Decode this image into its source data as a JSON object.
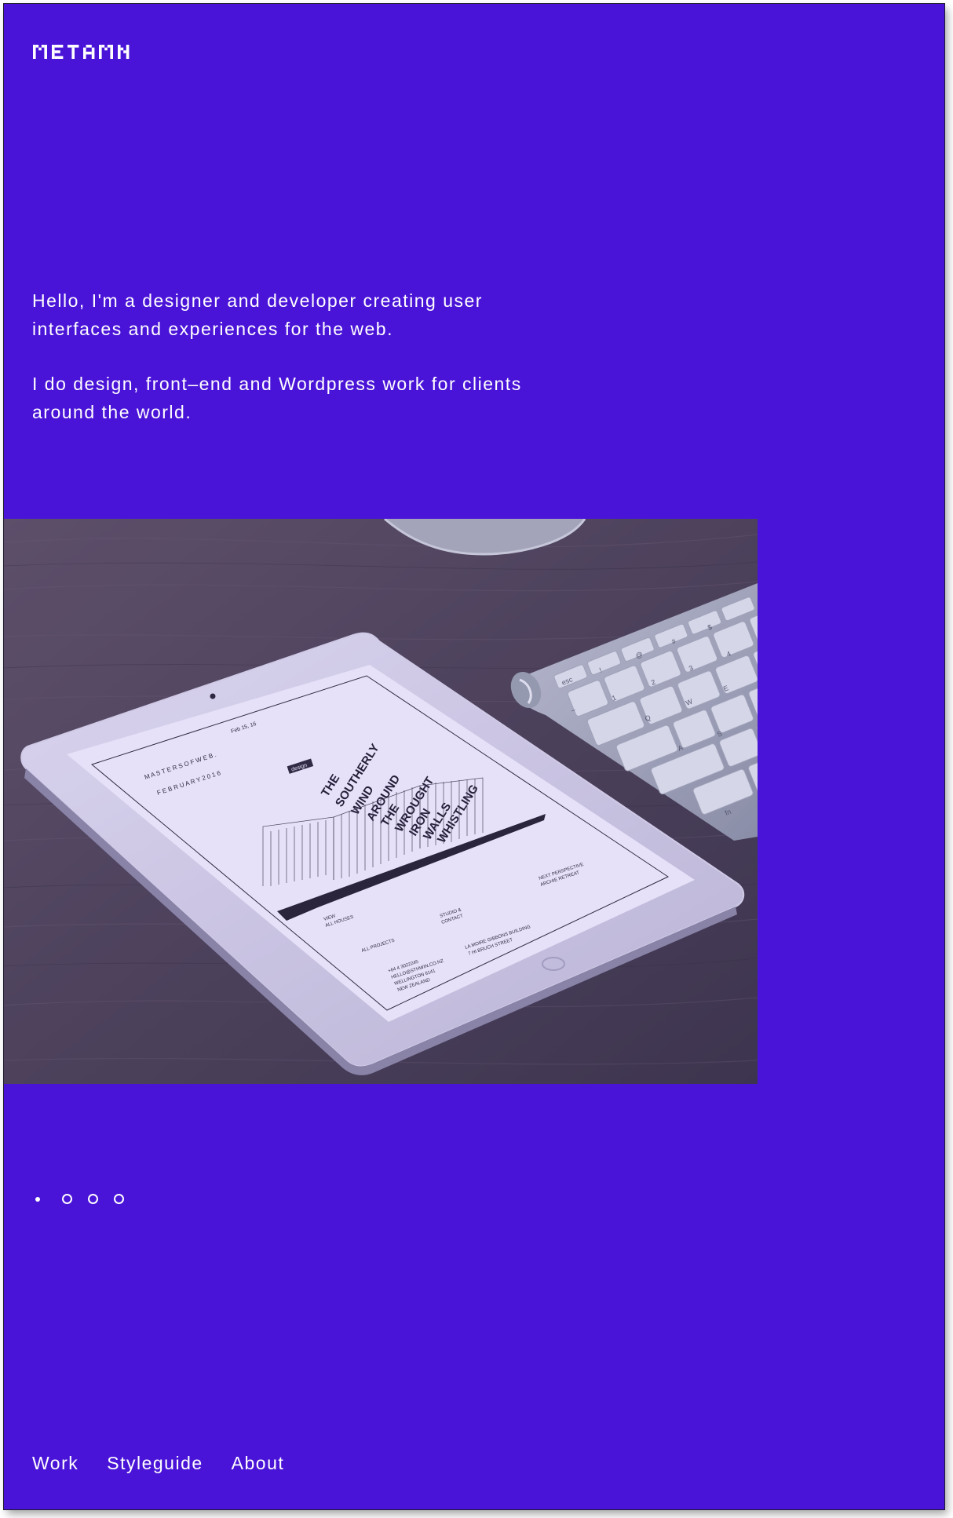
{
  "brand": {
    "logo_text": "METAMN",
    "accent": "#4a14d8",
    "text_color": "#ffffff"
  },
  "intro": {
    "paragraphs": [
      "Hello, I'm a designer and developer creating user interfaces and experiences for the web.",
      "I do design, front–end and Wordpress work for clients around the world."
    ]
  },
  "hero": {
    "alt": "iPad showing a poster design next to a keyboard on a wooden desk",
    "poster": {
      "date": "Feb 15, 16",
      "heading_line1": "M A S T E R S   O F   W E B .",
      "heading_line2": "F E B R U A R Y   2 0 1 6",
      "tag": "design",
      "headline": [
        "THE",
        "SOUTHERLY",
        "WIND",
        "AROUND",
        "THE",
        "WROUGHT",
        "IRON",
        "WALLS",
        "WHISTLING"
      ],
      "footer_view": "VIEW",
      "footer_all_houses": "ALL HOUSES",
      "footer_studio": "STUDIO &",
      "footer_contact": "CONTACT",
      "footer_next": "NEXT PERSPECTIVE",
      "footer_arch": "ARCHIE RETREAT",
      "footer_all_projects": "ALL PROJECTS",
      "footer_phone": "+64 4 3022245",
      "footer_email": "HELLO@STHWIN.CO.NZ",
      "footer_city": "WELLINGTON 6141",
      "footer_country": "NEW ZEALAND",
      "footer_building": "LA MOIRE GIBBONS BUILDING",
      "footer_street": "7 HI BRUCH STREET"
    },
    "keyboard_keys": [
      "esc",
      "!",
      "@",
      "#",
      "$",
      "~",
      "1",
      "2",
      "3",
      "4",
      "Q",
      "W",
      "E",
      "A",
      "S",
      "fn"
    ]
  },
  "carousel": {
    "slide_count": 4,
    "active_index": 0
  },
  "nav": {
    "items": [
      "Work",
      "Styleguide",
      "About"
    ]
  }
}
